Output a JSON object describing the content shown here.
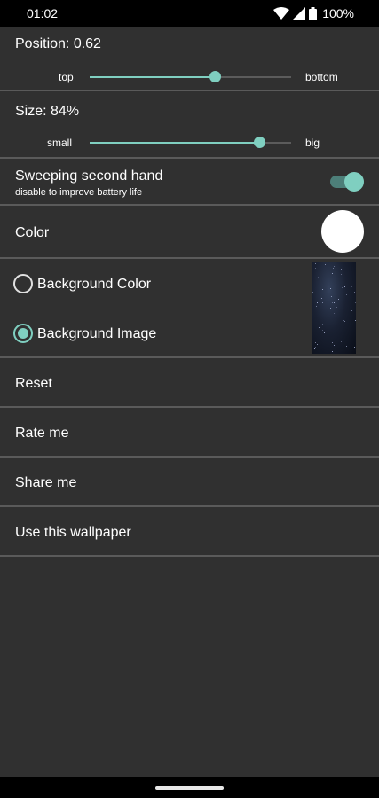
{
  "status_bar": {
    "time": "01:02",
    "battery": "100%",
    "icons": [
      "wifi-icon",
      "signal-icon",
      "battery-icon"
    ]
  },
  "position": {
    "label": "Position: 0.62",
    "min_label": "top",
    "max_label": "bottom",
    "value": 0.62
  },
  "size": {
    "label": "Size: 84%",
    "min_label": "small",
    "max_label": "big",
    "value": 0.84
  },
  "sweeping": {
    "title": "Sweeping second hand",
    "subtitle": "disable to improve battery life",
    "enabled": true
  },
  "color": {
    "label": "Color",
    "value": "#ffffff"
  },
  "background": {
    "color_option": "Background Color",
    "image_option": "Background Image",
    "selected": "image"
  },
  "menu": {
    "reset": "Reset",
    "rate": "Rate me",
    "share": "Share me",
    "use": "Use this wallpaper"
  },
  "theme": {
    "accent": "#7fcfc0",
    "background": "#303030"
  }
}
